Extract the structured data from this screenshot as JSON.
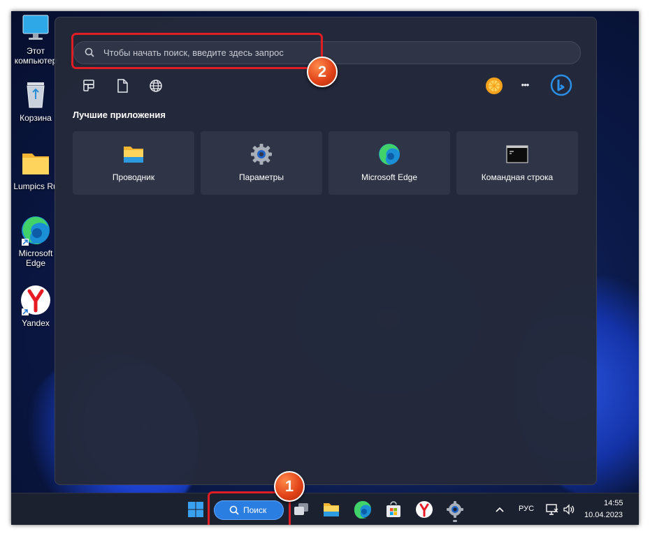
{
  "desktop": {
    "icons": [
      {
        "name": "this-pc",
        "label": "Этот компьютер",
        "icon": "monitor-icon"
      },
      {
        "name": "recycle-bin",
        "label": "Корзина",
        "icon": "recycle-bin-icon"
      },
      {
        "name": "lumpics-folder",
        "label": "Lumpics Ru",
        "icon": "folder-icon"
      },
      {
        "name": "microsoft-edge",
        "label": "Microsoft Edge",
        "icon": "edge-icon"
      },
      {
        "name": "yandex",
        "label": "Yandex",
        "icon": "yandex-icon"
      }
    ]
  },
  "start_panel": {
    "search_placeholder": "Чтобы начать поиск, введите здесь запрос",
    "filters": [
      {
        "name": "apps-filter",
        "icon": "apps-grid-icon"
      },
      {
        "name": "documents-filter",
        "icon": "document-icon"
      },
      {
        "name": "web-filter",
        "icon": "globe-icon"
      }
    ],
    "more_label": "•••",
    "top_apps_title": "Лучшие приложения",
    "top_apps": [
      {
        "name": "explorer",
        "label": "Проводник",
        "icon": "folder-icon"
      },
      {
        "name": "settings",
        "label": "Параметры",
        "icon": "gear-icon"
      },
      {
        "name": "edge",
        "label": "Microsoft Edge",
        "icon": "edge-icon"
      },
      {
        "name": "cmd",
        "label": "Командная строка",
        "icon": "terminal-icon"
      }
    ]
  },
  "annotations": {
    "step1": "1",
    "step2": "2",
    "color": "#e11d24"
  },
  "taskbar": {
    "search_label": "Поиск",
    "language": "РУС",
    "time": "14:55",
    "date": "10.04.2023",
    "accent": "#2a7de1"
  }
}
